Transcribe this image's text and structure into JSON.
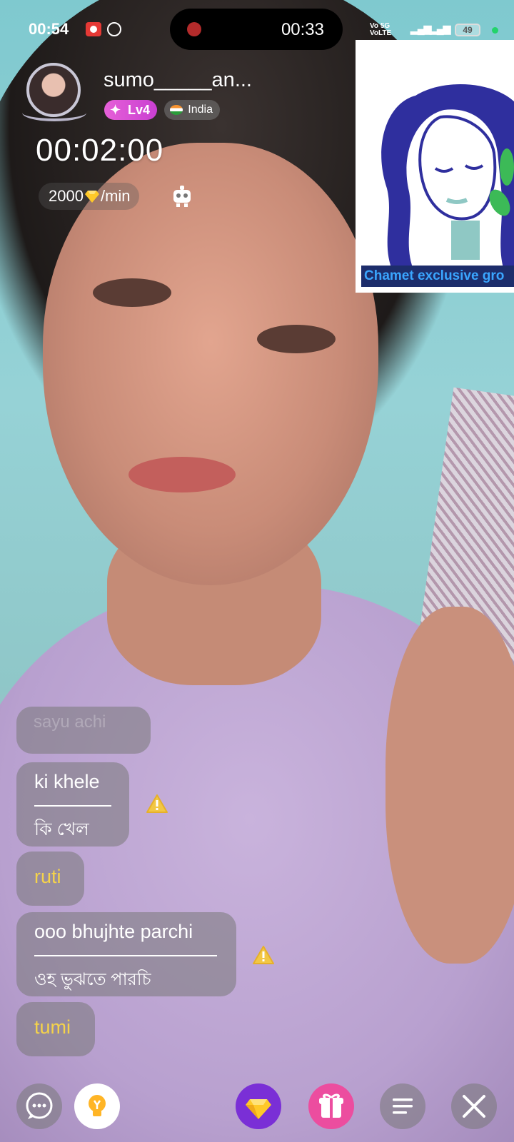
{
  "status_bar": {
    "time": "00:54",
    "call_time": "00:33",
    "network_label": "Vo 5G\nVoLTE",
    "network2": "5G",
    "battery": "49"
  },
  "host": {
    "name": "sumo_____an...",
    "level": "Lv4",
    "country": "India",
    "call_timer": "00:02:00",
    "rate_value": "2000",
    "rate_unit": "/min"
  },
  "ad": {
    "caption": "Chamet exclusive gro"
  },
  "chat": {
    "messages": [
      {
        "original": "sayu achi"
      },
      {
        "original": "ki khele",
        "translation": "কি খেল"
      },
      {
        "original": "ruti"
      },
      {
        "original": "ooo bhujhte parchi",
        "translation": "ওহ ভুঝতে পারচি"
      },
      {
        "original": "tumi"
      }
    ]
  },
  "icons": {
    "chat": "chat-bubble-icon",
    "tip": "lightbulb-icon",
    "gem": "diamond-icon",
    "gift": "gift-icon",
    "menu": "menu-icon",
    "close": "close-icon",
    "warning": "warning-icon",
    "robot": "robot-icon"
  },
  "colors": {
    "level_badge": "#d94fd6",
    "gem_button": "#7a2fd6",
    "gift_button": "#ec4d9f",
    "chat_highlight": "#f5d34a",
    "ad_caption_bg": "#1d2d6b",
    "ad_caption_text": "#3aa6ff"
  }
}
